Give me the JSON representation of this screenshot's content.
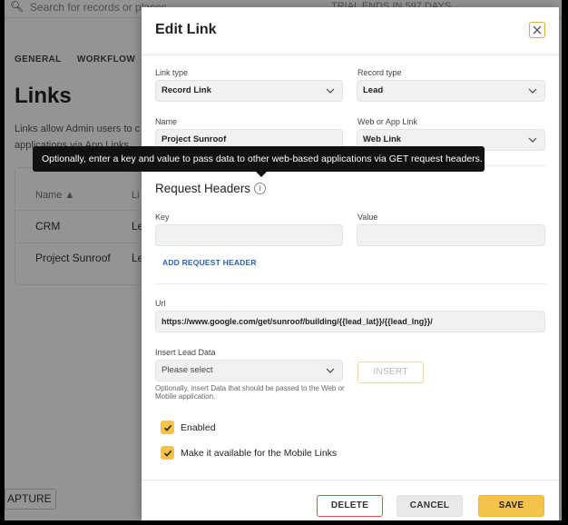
{
  "background": {
    "search_placeholder": "Search for records or places",
    "search_right_text": "TRIAL ENDS IN 597 DAYS",
    "tabs": [
      "GENERAL",
      "WORKFLOW",
      "U"
    ],
    "page_title": "Links",
    "description_lines": [
      "Links allow Admin users to c",
      "applications via App Links."
    ],
    "table": {
      "col_name": "Name",
      "col_second": "Li",
      "rows": [
        {
          "name": "CRM",
          "second": "Le"
        },
        {
          "name": "Project Sunroof",
          "second": "Le"
        }
      ]
    },
    "capture_button": "APTURE"
  },
  "modal": {
    "title": "Edit Link",
    "link_type": {
      "label": "Link type",
      "value": "Record Link"
    },
    "record_type": {
      "label": "Record type",
      "value": "Lead"
    },
    "name": {
      "label": "Name",
      "value": "Project Sunroof"
    },
    "web_or_app": {
      "label": "Web or App Link",
      "value": "Web Link"
    },
    "request_headers": {
      "title": "Request Headers",
      "info_glyph": "i",
      "tooltip": "Optionally, enter a key and value to pass data to other web-based applications via GET request headers.",
      "key_label": "Key",
      "value_label": "Value",
      "key_value": "",
      "value_value": "",
      "add_label": "ADD REQUEST HEADER"
    },
    "url": {
      "label": "Url",
      "value": "https://www.google.com/get/sunroof/building/{{lead_lat}}/{{lead_lng}}/"
    },
    "insert_lead_data": {
      "label": "Insert Lead Data",
      "placeholder": "Please select",
      "hint": "Optionally, insert Data that should be passed to the Web or Mobile application.",
      "insert_label": "INSERT"
    },
    "enabled": {
      "label": "Enabled",
      "checked": true
    },
    "mobile": {
      "label": "Make it available for the Mobile Links",
      "checked": true
    },
    "footer": {
      "delete": "DELETE",
      "cancel": "CANCEL",
      "save": "SAVE"
    }
  },
  "colors": {
    "accent": "#f5c24a",
    "danger": "#d9534f",
    "link": "#2a62b8"
  }
}
